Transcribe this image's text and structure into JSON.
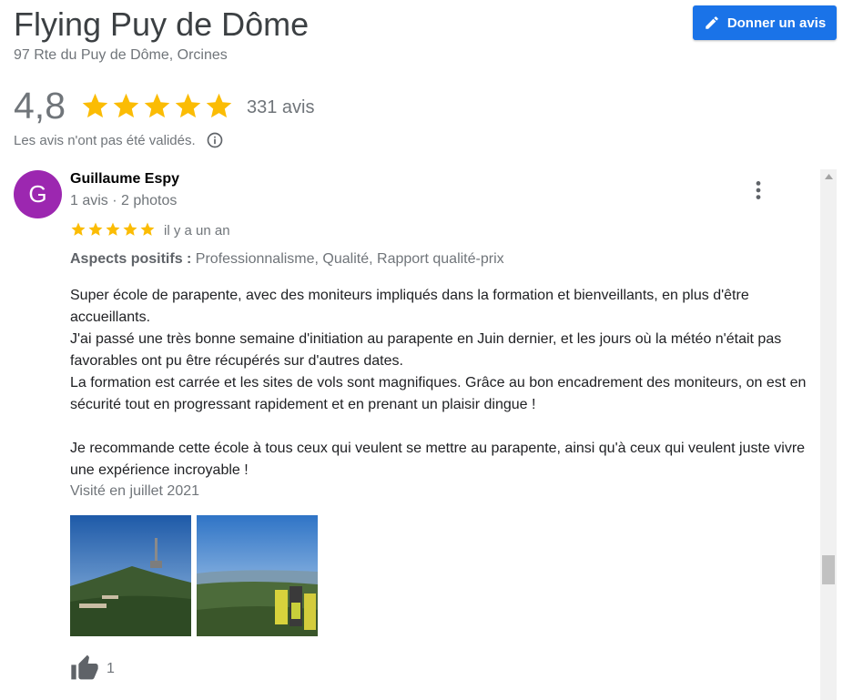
{
  "place": {
    "title": "Flying Puy de Dôme",
    "address": "97 Rte du Puy de Dôme, Orcines"
  },
  "actions": {
    "write_review_label": "Donner un avis",
    "write_review_icon": "pencil-icon"
  },
  "rating": {
    "value": "4,8",
    "stars": 5,
    "count_label": "331 avis",
    "validation_notice": "Les avis n'ont pas été validés."
  },
  "review": {
    "avatar_letter": "G",
    "avatar_color": "#9c27b0",
    "author": "Guillaume Espy",
    "author_meta": "1 avis · 2 photos",
    "stars": 5,
    "date": "il y a un an",
    "aspects_label": "Aspects positifs :",
    "aspects_values": " Professionnalisme, Qualité, Rapport qualité-prix",
    "text_lines": [
      "Super école de parapente, avec des moniteurs impliqués dans la formation et bienveillants, en plus d'être accueillants.",
      "J'ai passé une très bonne semaine d'initiation au parapente en Juin dernier, et les jours où la météo n'était pas favorables ont pu être récupérés sur d'autres dates.",
      "La formation est carrée et les sites de vols sont magnifiques. Grâce au bon encadrement des moniteurs, on est en sécurité tout en progressant rapidement et en prenant un plaisir dingue !",
      "Je recommande cette école à tous ceux qui veulent se mettre au parapente, ainsi qu'à ceux qui veulent juste vivre une expérience incroyable !"
    ],
    "visited": "Visité en juillet 2021",
    "photos": [
      "photo-summit-antenna",
      "photo-paraglider-group"
    ],
    "likes": "1"
  },
  "colors": {
    "accent": "#1a73e8",
    "star": "#fbbc04",
    "muted_text": "#70757a"
  }
}
